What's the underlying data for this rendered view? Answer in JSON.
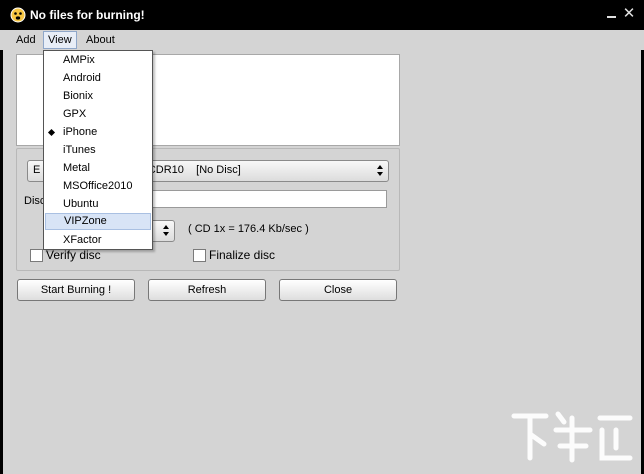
{
  "window": {
    "title": "No files for burning!",
    "close_glyph": "✕"
  },
  "menu": {
    "add": "Add",
    "view": "View",
    "about": "About"
  },
  "view_menu": {
    "items": [
      {
        "label": "AMPix",
        "checked": false,
        "hover": false
      },
      {
        "label": "Android",
        "checked": false,
        "hover": false
      },
      {
        "label": "Bionix",
        "checked": false,
        "hover": false
      },
      {
        "label": "GPX",
        "checked": false,
        "hover": false
      },
      {
        "label": "iPhone",
        "checked": true,
        "hover": false
      },
      {
        "label": "iTunes",
        "checked": false,
        "hover": false
      },
      {
        "label": "Metal",
        "checked": false,
        "hover": false
      },
      {
        "label": "MSOffice2010",
        "checked": false,
        "hover": false
      },
      {
        "label": "Ubuntu",
        "checked": false,
        "hover": false
      },
      {
        "label": "VIPZone",
        "checked": false,
        "hover": true
      },
      {
        "label": "XFactor",
        "checked": false,
        "hover": false
      }
    ]
  },
  "drive": {
    "selected_prefix": "E :",
    "selected_suffix": "IDE CDR10    [No Disc]"
  },
  "disc_label": "Disc",
  "speed_note": "( CD 1x = 176.4 Kb/sec )",
  "options": {
    "verify": "Verify disc",
    "finalize": "Finalize disc"
  },
  "buttons": {
    "start": "Start Burning !",
    "refresh": "Refresh",
    "close": "Close"
  },
  "colors": {
    "titlebar": "#000000",
    "menu_hover": "#d8e4f6",
    "window_bg": "#d4d4d4"
  }
}
